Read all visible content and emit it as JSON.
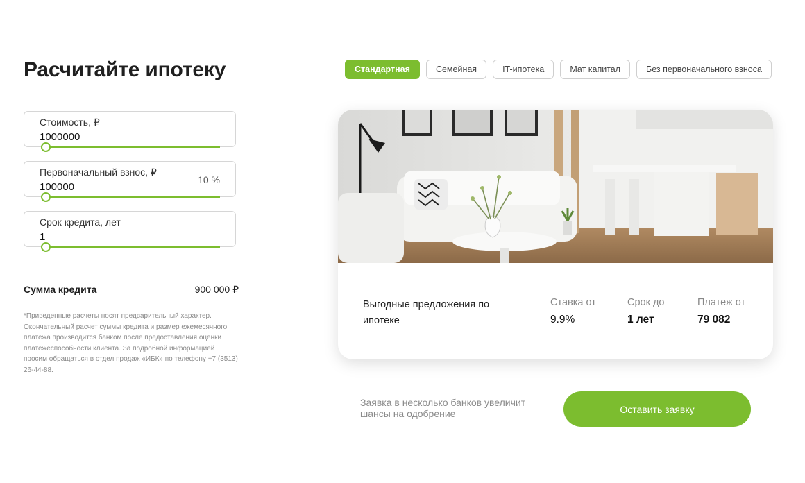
{
  "page_title": "Расчитайте ипотеку",
  "fields": [
    {
      "label": "Стоимость, ₽",
      "value": "1000000",
      "slider_fraction": 0
    },
    {
      "label": "Первоначальный взнос, ₽",
      "value": "100000",
      "percent": "10 %",
      "slider_fraction": 0
    },
    {
      "label": "Срок кредита, лет",
      "value": "1",
      "slider_fraction": 0
    }
  ],
  "summary": {
    "label": "Сумма кредита",
    "value": "900 000 ₽"
  },
  "disclaimer": "*Приведенные расчеты носят предварительный характер. Окончательный расчет суммы кредита и размер ежемесячного платежа производится банком после предоставления оценки платежеспособности клиента. За подробной информацией просим обращаться в отдел продаж «ИБК» по телефону +7 (3513) 26-44-88.",
  "tabs": [
    {
      "label": "Стандартная",
      "active": true
    },
    {
      "label": "Семейная",
      "active": false
    },
    {
      "label": "IT-ипотека",
      "active": false
    },
    {
      "label": "Мат капитал",
      "active": false
    },
    {
      "label": "Без первоначального взноса",
      "active": false
    }
  ],
  "offer": {
    "label": "Выгодные предложения по ипотеке",
    "rate": {
      "label": "Ставка от",
      "value": "9.9%"
    },
    "term": {
      "label": "Срок до",
      "value": "1 лет"
    },
    "payment": {
      "label": "Платеж от",
      "value": "79 082"
    }
  },
  "cta": {
    "text": "Заявка в несколько банков увеличит шансы на одобрение",
    "button": "Оставить заявку"
  },
  "colors": {
    "accent": "#7cbd2f",
    "muted_text": "#8a8a8a"
  }
}
